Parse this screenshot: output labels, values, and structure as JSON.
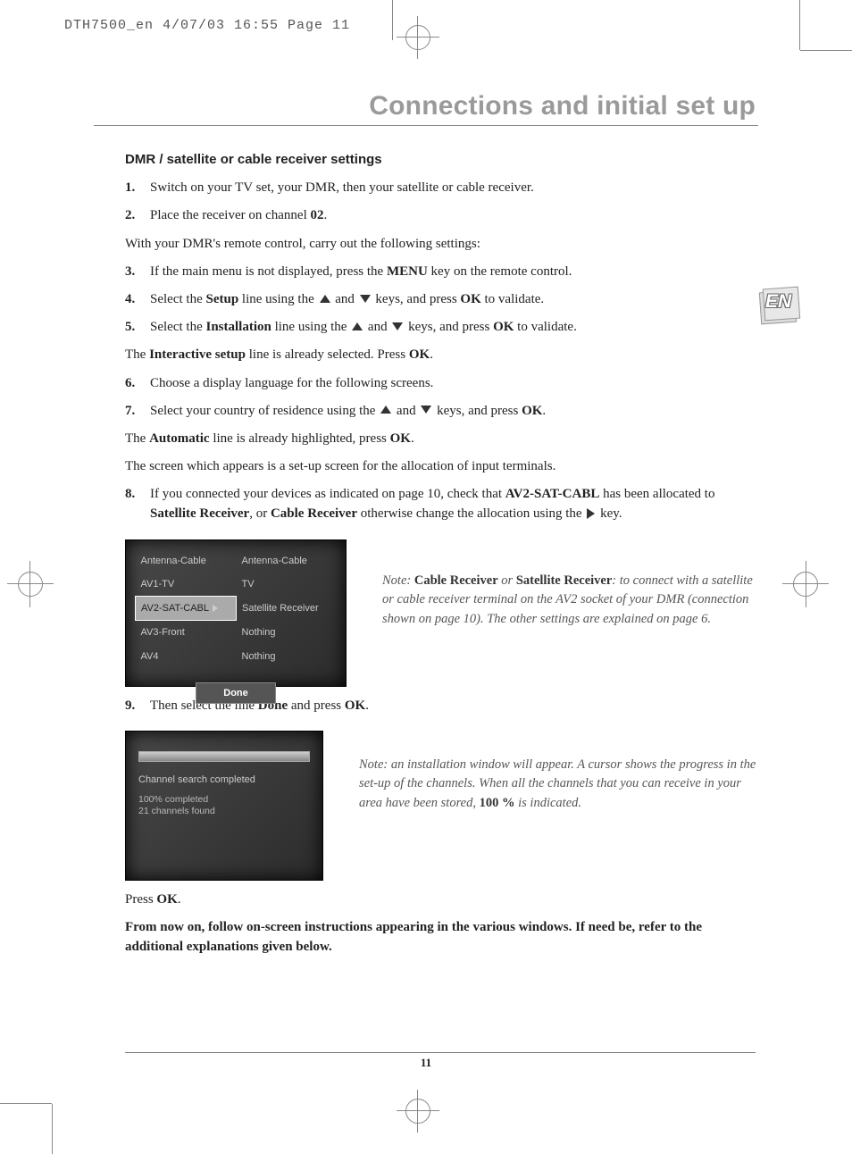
{
  "slug": "DTH7500_en  4/07/03  16:55  Page 11",
  "title": "Connections and initial set up",
  "lang_badge": "EN",
  "section_head": "DMR / satellite or cable receiver settings",
  "steps": {
    "s1": {
      "n": "1.",
      "t": "Switch on your TV set, your DMR, then your satellite or cable receiver."
    },
    "s2": {
      "n": "2.",
      "pre": "Place the receiver on channel ",
      "b": "02",
      "post": "."
    },
    "p_after2": "With your DMR's remote control, carry out the following settings:",
    "s3": {
      "n": "3.",
      "pre": "If the main menu is not displayed, press the ",
      "b": "MENU",
      "post": " key on the remote control."
    },
    "s4": {
      "n": "4.",
      "pre": "Select the ",
      "b1": "Setup",
      "mid": " line using the ",
      "mid2": " and ",
      "mid3": " keys, and press ",
      "b2": "OK",
      "post": " to validate."
    },
    "s5": {
      "n": "5.",
      "pre": "Select the ",
      "b1": "Installation",
      "mid": " line using the ",
      "mid2": " and ",
      "mid3": " keys, and press ",
      "b2": "OK",
      "post": " to validate."
    },
    "p_after5_pre": "The ",
    "p_after5_b": "Interactive setup",
    "p_after5_mid": " line is already selected. Press ",
    "p_after5_b2": "OK",
    "p_after5_post": ".",
    "s6": {
      "n": "6.",
      "t": "Choose a display language for the following screens."
    },
    "s7": {
      "n": "7.",
      "pre": "Select your country of residence using the ",
      "mid": " and ",
      "mid2": " keys, and press ",
      "b": "OK",
      "post": "."
    },
    "p_after7_pre": "The ",
    "p_after7_b": "Automatic",
    "p_after7_mid": " line is already highlighted, press ",
    "p_after7_b2": "OK",
    "p_after7_post": ".",
    "p_screen": "The screen which appears is a set-up screen for the allocation of input terminals.",
    "s8": {
      "n": "8.",
      "pre": "If you connected your devices as indicated on page 10, check that ",
      "b1": "AV2-SAT-CABL",
      "mid": " has been allocated to ",
      "b2": "Satellite Receiver",
      "mid2": ", or ",
      "b3": "Cable Receiver",
      "mid3": " otherwise change the allocation using the ",
      "post": " key."
    },
    "s9": {
      "n": "9.",
      "pre": "Then select the line ",
      "b1": "Done",
      "mid": " and press ",
      "b2": "OK",
      "post": "."
    }
  },
  "shot1": {
    "rows": [
      {
        "l": "Antenna-Cable",
        "r": "Antenna-Cable"
      },
      {
        "l": "AV1-TV",
        "r": "TV"
      },
      {
        "l": "AV2-SAT-CABL",
        "r": "Satellite Receiver",
        "sel": true
      },
      {
        "l": "AV3-Front",
        "r": "Nothing"
      },
      {
        "l": "AV4",
        "r": "Nothing"
      }
    ],
    "done": "Done"
  },
  "note1": {
    "pre": "Note: ",
    "b1": "Cable Receiver",
    "mid1": " or ",
    "b2": "Satellite Receiver",
    "rest": ": to connect with a satellite or cable receiver terminal on the AV2 socket of your DMR (connection shown on page 10). The other settings are explained on page 6."
  },
  "shot2": {
    "l1": "Channel search completed",
    "l2": "100% completed",
    "l3": "21 channels found"
  },
  "note2": {
    "pre": "Note: an installation window will appear. A cursor shows the progress in the set-up of the channels. When all the channels that you can receive in your area have been stored, ",
    "b": "100 %",
    "post": " is indicated."
  },
  "press_ok_pre": "Press ",
  "press_ok_b": "OK",
  "press_ok_post": ".",
  "final_bold": "From now on, follow on-screen instructions appearing in the various windows. If need be, refer to the additional explanations given below.",
  "page_num": "11"
}
